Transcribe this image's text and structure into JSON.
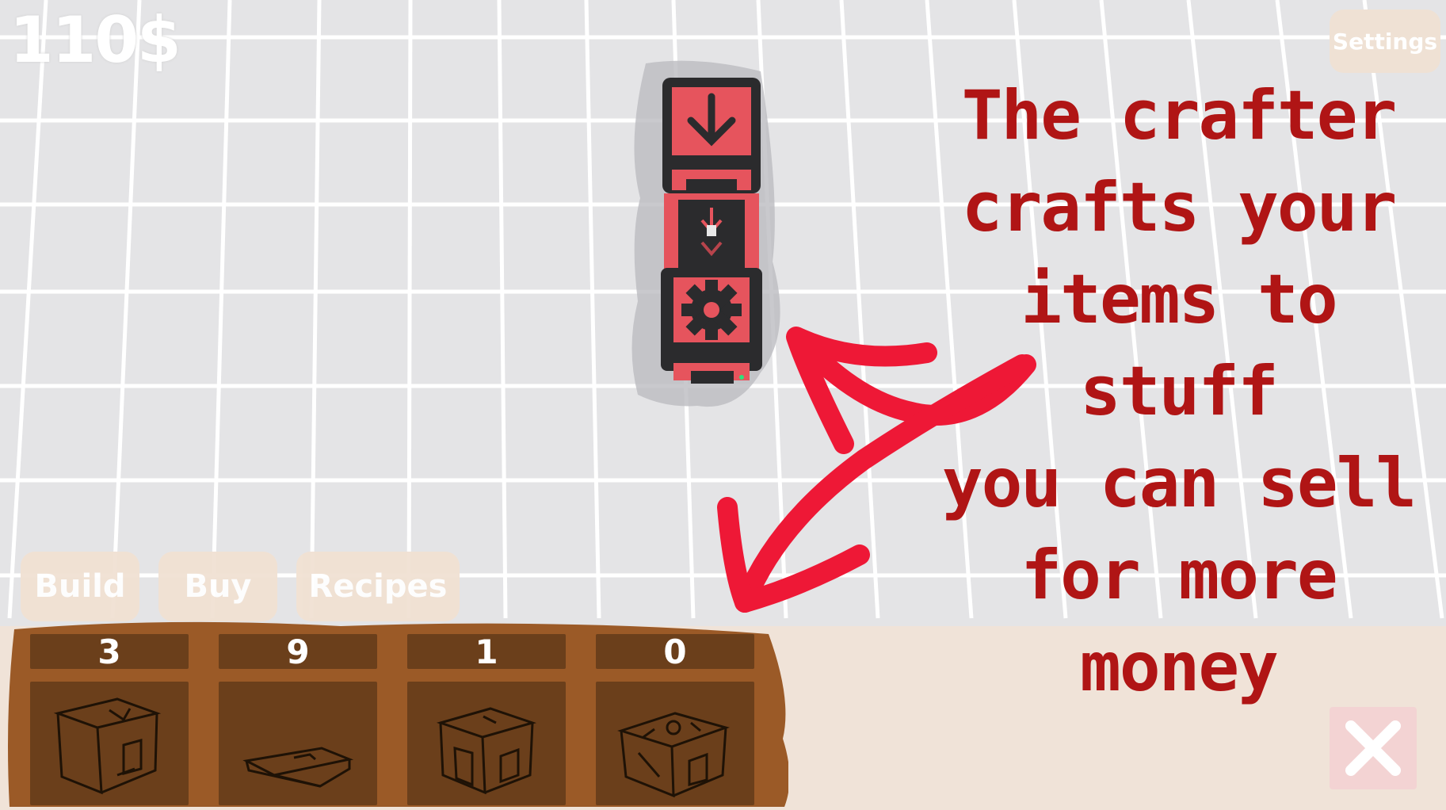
{
  "hud": {
    "money": "110$",
    "settings_label": "Settings"
  },
  "tabs": [
    {
      "label": "Build"
    },
    {
      "label": "Buy"
    },
    {
      "label": "Recipes"
    }
  ],
  "inventory": [
    {
      "count": "3",
      "icon": "crafter-sketch-icon"
    },
    {
      "count": "9",
      "icon": "conveyor-sketch-icon"
    },
    {
      "count": "1",
      "icon": "box-sketch-icon"
    },
    {
      "count": "0",
      "icon": "seller-sketch-icon"
    }
  ],
  "tutorial": {
    "text": "The crafter\ncrafts your\nitems to\nstuff\nyou can sell\nfor more\nmoney"
  },
  "close_icon": "close-icon",
  "colors": {
    "floor": "#e4e4e6",
    "grid": "#ffffff",
    "machine_red": "#e6545d",
    "machine_dark": "#2b2b2d",
    "arrow_red": "#ee1836",
    "annotation_text": "#b01515",
    "bar_bg": "#f0e3d8",
    "wood": "#9b5a27",
    "slot": "#6b3f1b",
    "button": "#f1e1d3"
  }
}
